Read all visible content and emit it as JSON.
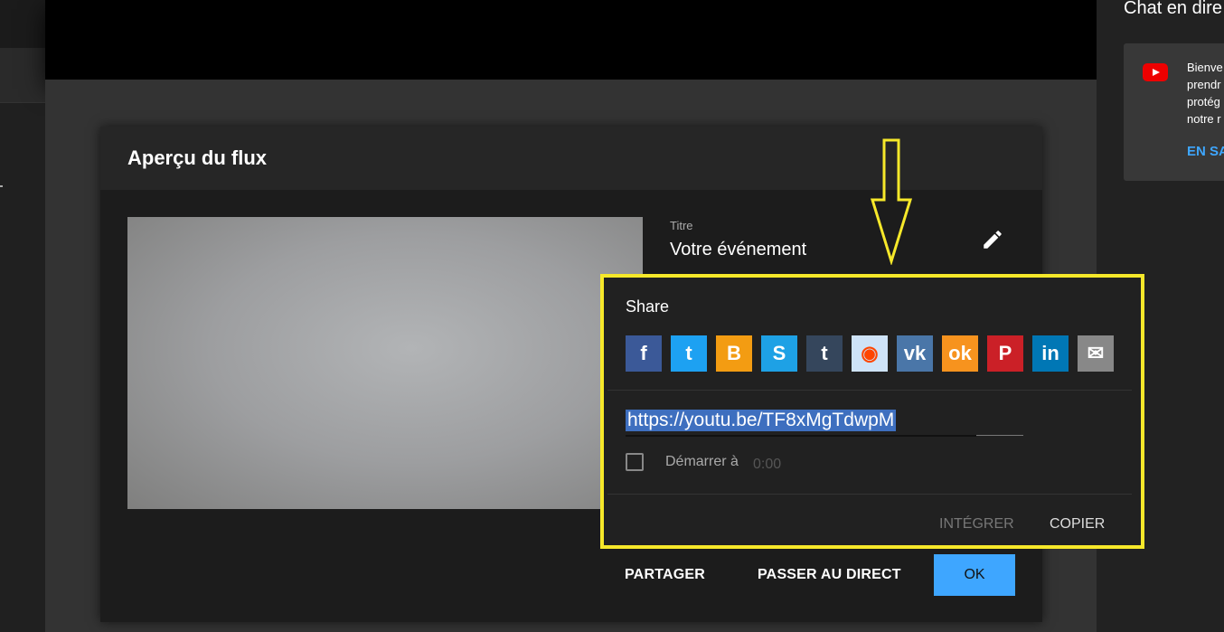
{
  "chat": {
    "title": "Chat en dire",
    "message_lines": "Bienve\nprendr\nprotég\nnotre r",
    "link": "EN SA"
  },
  "dialog": {
    "title": "Aperçu du flux",
    "meta_label": "Titre",
    "meta_value": "Votre événement",
    "share_button": "PARTAGER",
    "go_live_button": "PASSER AU DIRECT",
    "ok_button": "OK"
  },
  "share": {
    "title": "Share",
    "icons": [
      {
        "name": "facebook-icon",
        "glyph": "f",
        "color": "#3b5998"
      },
      {
        "name": "twitter-icon",
        "glyph": "t",
        "color": "#1da1f2"
      },
      {
        "name": "blogger-icon",
        "glyph": "B",
        "color": "#f39c12"
      },
      {
        "name": "livejournal-icon",
        "glyph": "S",
        "color": "#1ea1e5"
      },
      {
        "name": "tumblr-icon",
        "glyph": "t",
        "color": "#35465c"
      },
      {
        "name": "reddit-icon",
        "glyph": "◉",
        "color": "#cee3f8"
      },
      {
        "name": "vk-icon",
        "glyph": "vk",
        "color": "#4a76a8"
      },
      {
        "name": "odnoklassniki-icon",
        "glyph": "ok",
        "color": "#f7931e"
      },
      {
        "name": "pinterest-icon",
        "glyph": "P",
        "color": "#cb2027"
      },
      {
        "name": "linkedin-icon",
        "glyph": "in",
        "color": "#0077b5"
      },
      {
        "name": "email-icon",
        "glyph": "✉",
        "color": "#888888"
      }
    ],
    "url": "https://youtu.be/TF8xMgTdwpM",
    "start_label": "Démarrer à",
    "start_time": "0:00",
    "embed_button": "INTÉGRER",
    "copy_button": "COPIER"
  }
}
